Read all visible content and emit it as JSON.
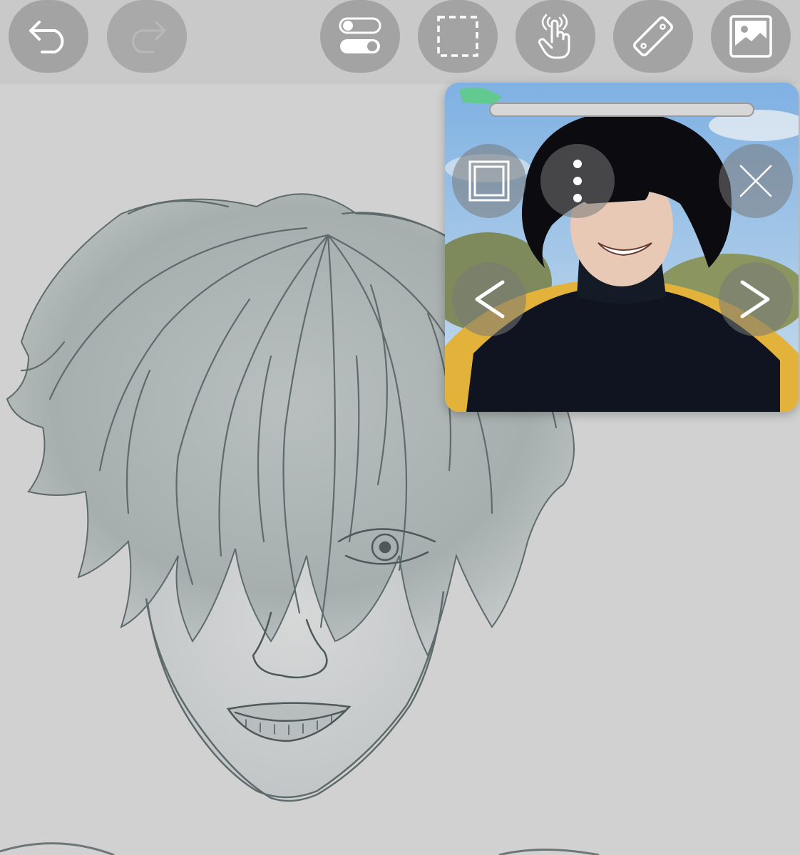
{
  "toolbar": {
    "buttons": [
      {
        "id": "undo",
        "icon": "undo-arrow-icon",
        "enabled": true
      },
      {
        "id": "redo",
        "icon": "redo-arrow-icon",
        "enabled": false
      },
      {
        "id": "toggles",
        "icon": "toggle-switches-icon",
        "enabled": true
      },
      {
        "id": "selection",
        "icon": "dashed-selection-icon",
        "enabled": true
      },
      {
        "id": "gesture",
        "icon": "touch-gesture-icon",
        "enabled": true
      },
      {
        "id": "ruler",
        "icon": "ruler-icon",
        "enabled": true
      },
      {
        "id": "reference-image",
        "icon": "image-icon",
        "enabled": true
      }
    ]
  },
  "reference_window": {
    "controls": [
      {
        "id": "fit",
        "icon": "square-frame-icon"
      },
      {
        "id": "menu",
        "icon": "vertical-dots-icon"
      },
      {
        "id": "close",
        "icon": "close-x-icon"
      },
      {
        "id": "previous",
        "icon": "chevron-left-icon"
      },
      {
        "id": "next",
        "icon": "chevron-right-icon"
      }
    ]
  },
  "colors": {
    "toolbar_bg": "#c9c9c9",
    "button_bg": "#a3a3a3",
    "canvas_bg": "#d1d1d1",
    "icon_color": "#ffffff",
    "sketch_line": "#5f6b6b"
  }
}
